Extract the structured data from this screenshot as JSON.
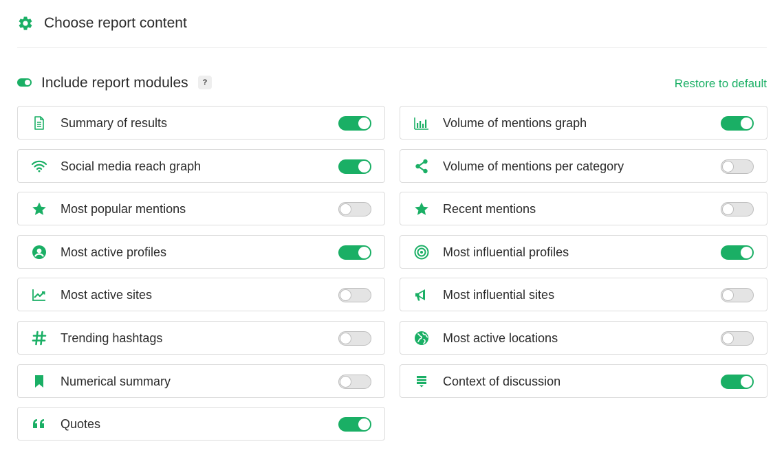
{
  "header": {
    "title": "Choose report content"
  },
  "modules": {
    "label": "Include report modules",
    "help": "?",
    "restore_label": "Restore to default"
  },
  "left": [
    {
      "label": "Summary of results",
      "icon": "document-icon",
      "enabled": true
    },
    {
      "label": "Social media reach graph",
      "icon": "wifi-icon",
      "enabled": true
    },
    {
      "label": "Most popular mentions",
      "icon": "star-icon",
      "enabled": false
    },
    {
      "label": "Most active profiles",
      "icon": "profile-icon",
      "enabled": true
    },
    {
      "label": "Most active sites",
      "icon": "trend-chart-icon",
      "enabled": false
    },
    {
      "label": "Trending hashtags",
      "icon": "hashtag-icon",
      "enabled": false
    },
    {
      "label": "Numerical summary",
      "icon": "bookmark-icon",
      "enabled": false
    },
    {
      "label": "Quotes",
      "icon": "quote-icon",
      "enabled": true
    }
  ],
  "right": [
    {
      "label": "Volume of mentions graph",
      "icon": "bar-chart-icon",
      "enabled": true
    },
    {
      "label": "Volume of mentions per category",
      "icon": "share-icon",
      "enabled": false
    },
    {
      "label": "Recent mentions",
      "icon": "star-icon",
      "enabled": false
    },
    {
      "label": "Most influential profiles",
      "icon": "target-icon",
      "enabled": true
    },
    {
      "label": "Most influential sites",
      "icon": "megaphone-icon",
      "enabled": false
    },
    {
      "label": "Most active locations",
      "icon": "globe-icon",
      "enabled": false
    },
    {
      "label": "Context of discussion",
      "icon": "context-icon",
      "enabled": true
    }
  ],
  "colors": {
    "accent": "#1aaf65",
    "toggle_off": "#e4e4e4",
    "border": "#dcdcdc"
  }
}
